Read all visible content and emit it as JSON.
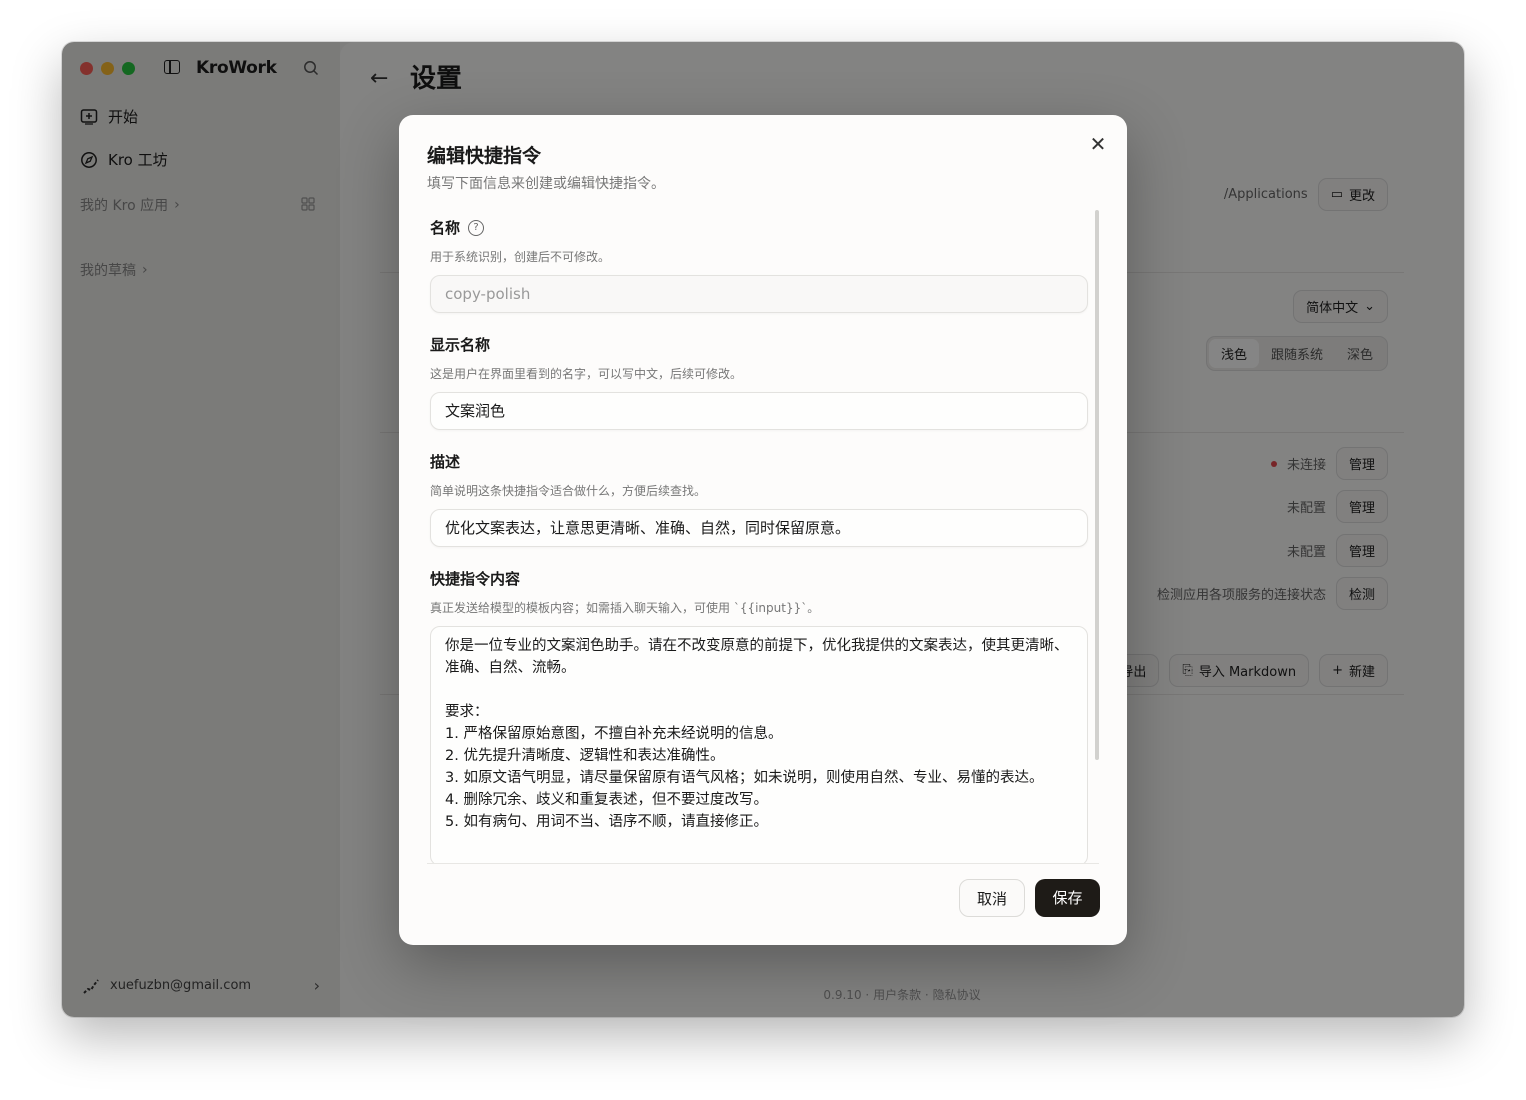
{
  "app": {
    "title": "KroWork"
  },
  "sidebar": {
    "items": [
      {
        "label": "开始"
      },
      {
        "label": "Kro 工坊"
      }
    ],
    "sections": [
      {
        "label": "我的 Kro 应用"
      },
      {
        "label": "我的草稿"
      }
    ],
    "user_email": "xuefuzbn@gmail.com"
  },
  "main": {
    "title": "设置",
    "path_label": "/Applications",
    "change_button": "更改",
    "language_value": "简体中文",
    "theme_options": [
      "浅色",
      "跟随系统",
      "深色"
    ],
    "theme_selected": "浅色",
    "services": [
      {
        "status": "未连接",
        "action": "管理"
      },
      {
        "status": "未配置",
        "action": "管理"
      },
      {
        "status": "未配置",
        "action": "管理"
      }
    ],
    "check_hint": "检测应用各项服务的连接状态",
    "check_button": "检测",
    "export_button": "导出",
    "import_button": "导入 Markdown",
    "new_button": "新建",
    "footer": {
      "version": "0.9.10",
      "terms": "用户条款",
      "privacy": "隐私协议",
      "separator": "·"
    }
  },
  "modal": {
    "title": "编辑快捷指令",
    "subtitle": "填写下面信息来创建或编辑快捷指令。",
    "fields": {
      "name": {
        "label": "名称",
        "hint": "用于系统识别，创建后不可修改。",
        "value": "copy-polish"
      },
      "display_name": {
        "label": "显示名称",
        "hint": "这是用户在界面里看到的名字，可以写中文，后续可修改。",
        "value": "文案润色"
      },
      "description": {
        "label": "描述",
        "hint": "简单说明这条快捷指令适合做什么，方便后续查找。",
        "value": "优化文案表达，让意思更清晰、准确、自然，同时保留原意。"
      },
      "content": {
        "label": "快捷指令内容",
        "hint": "真正发送给模型的模板内容；如需插入聊天输入，可使用 `{{input}}`。",
        "value": "你是一位专业的文案润色助手。请在不改变原意的前提下，优化我提供的文案表达，使其更清晰、准确、自然、流畅。\n\n要求：\n1. 严格保留原始意图，不擅自补充未经说明的信息。\n2. 优先提升清晰度、逻辑性和表达准确性。\n3. 如原文语气明显，请尽量保留原有语气风格；如未说明，则使用自然、专业、易懂的表达。\n4. 删除冗余、歧义和重复表述，但不要过度改写。\n5. 如有病句、用词不当、语序不顺，请直接修正。"
      }
    },
    "cancel_label": "取消",
    "save_label": "保存"
  }
}
